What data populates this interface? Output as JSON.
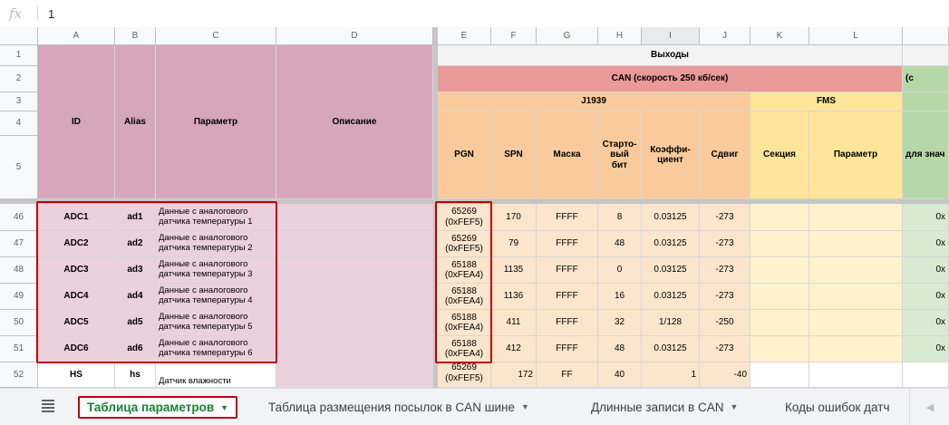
{
  "formula_bar": {
    "icon": "fx",
    "value": "1"
  },
  "columns": [
    "A",
    "B",
    "C",
    "D",
    "E",
    "F",
    "G",
    "H",
    "I",
    "J",
    "K",
    "L"
  ],
  "frozen_rows": [
    "1",
    "2",
    "3",
    "4",
    "5"
  ],
  "header": {
    "vykhody": "Выходы",
    "can": "CAN (скорость 250 кб/сек)",
    "green_cut2": "(с",
    "j1939": "J1939",
    "fms": "FMS",
    "id": "ID",
    "alias": "Alias",
    "param": "Параметр",
    "desc": "Описание",
    "pgn": "PGN",
    "spn": "SPN",
    "mask": "Маска",
    "start_bit": "Старто-\nвый\nбит",
    "coef": "Коэффи-\nциент",
    "shift": "Сдвиг",
    "section": "Секция",
    "fms_param": "Параметр",
    "green_cut5": "для знач"
  },
  "rows": [
    {
      "num": "46",
      "id": "ADC1",
      "alias": "ad1",
      "param": "Данные с аналогового датчика температуры 1",
      "pgn": "65269\n(0xFEF5)",
      "spn": "170",
      "mask": "FFFF",
      "start": "8",
      "coef": "0.03125",
      "shift": "-273",
      "m": "0x"
    },
    {
      "num": "47",
      "id": "ADC2",
      "alias": "ad2",
      "param": "Данные с аналогового датчика температуры 2",
      "pgn": "65269\n(0xFEF5)",
      "spn": "79",
      "mask": "FFFF",
      "start": "48",
      "coef": "0.03125",
      "shift": "-273",
      "m": "0x"
    },
    {
      "num": "48",
      "id": "ADC3",
      "alias": "ad3",
      "param": "Данные с аналогового датчика температуры 3",
      "pgn": "65188\n(0xFEA4)",
      "spn": "1135",
      "mask": "FFFF",
      "start": "0",
      "coef": "0.03125",
      "shift": "-273",
      "m": "0x"
    },
    {
      "num": "49",
      "id": "ADC4",
      "alias": "ad4",
      "param": "Данные с аналогового датчика температуры 4",
      "pgn": "65188\n(0xFEA4)",
      "spn": "1136",
      "mask": "FFFF",
      "start": "16",
      "coef": "0.03125",
      "shift": "-273",
      "m": "0x"
    },
    {
      "num": "50",
      "id": "ADC5",
      "alias": "ad5",
      "param": "Данные с аналогового датчика температуры 5",
      "pgn": "65188\n(0xFEA4)",
      "spn": "411",
      "mask": "FFFF",
      "start": "32",
      "coef": "1/128",
      "shift": "-250",
      "m": "0x"
    },
    {
      "num": "51",
      "id": "ADC6",
      "alias": "ad6",
      "param": "Данные с аналогового датчика температуры 6",
      "pgn": "65188\n(0xFEA4)",
      "spn": "412",
      "mask": "FFFF",
      "start": "48",
      "coef": "0.03125",
      "shift": "-273",
      "m": "0x"
    },
    {
      "num": "52",
      "id": "HS",
      "alias": "hs",
      "param": "Датчик влажности",
      "pgn": "65269\n(0xFEF5)",
      "spn": "172",
      "mask": "FF",
      "start": "40",
      "coef": "1",
      "shift": "-40",
      "m": ""
    }
  ],
  "tabs": [
    {
      "label": "Таблица параметров",
      "active": true
    },
    {
      "label": "Таблица размещения посылок в CAN шине",
      "active": false
    },
    {
      "label": "Длинные записи в CAN",
      "active": false
    },
    {
      "label": "Коды ошибок датч",
      "active": false
    }
  ]
}
